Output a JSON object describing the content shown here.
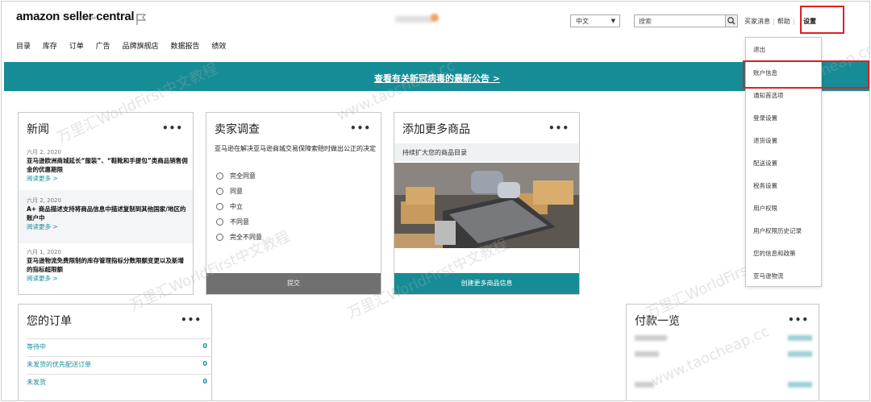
{
  "header": {
    "logo_main": "amazon seller central",
    "logo_sub": "europe",
    "language": "中文",
    "search_placeholder": "搜索",
    "links": [
      "买家消息",
      "帮助"
    ],
    "settings": "设置"
  },
  "nav": [
    "目录",
    "库存",
    "订单",
    "广告",
    "品牌旗舰店",
    "数据报告",
    "绩效"
  ],
  "banner": "查看有关新冠病毒的最新公告 >",
  "news": {
    "title": "新闻",
    "items": [
      {
        "date": "六月 2, 2020",
        "text": "亚马逊欧洲商城延长“服装”、“鞋靴和手提包”类商品销售佣金的优惠期限",
        "more": "阅读更多 >"
      },
      {
        "date": "六月 2, 2020",
        "text": "A+ 商品描述支持将商品信息中描述复制到其他国家/地区的账户中",
        "more": "阅读更多 >"
      },
      {
        "date": "六月 1, 2020",
        "text": "亚马逊物流免费限制的库存管理指标分数限额变更以及新增的指标超限额",
        "more": "阅读更多 >"
      }
    ]
  },
  "survey": {
    "title": "卖家调查",
    "question": "亚马逊在解决亚马逊商城交易保障索赔时做出公正的决定",
    "options": [
      "完全同意",
      "同意",
      "中立",
      "不同意",
      "完全不同意"
    ],
    "submit": "提交"
  },
  "add_products": {
    "title": "添加更多商品",
    "subtitle": "持续扩大您的商品目录",
    "button": "创建更多商品信息"
  },
  "orders": {
    "title": "您的订单",
    "rows": [
      {
        "label": "等待中",
        "count": "0"
      },
      {
        "label": "未发货的优先配送订单",
        "count": "0"
      },
      {
        "label": "未发货",
        "count": "0"
      }
    ]
  },
  "payments": {
    "title": "付款一览"
  },
  "dropdown": {
    "items": [
      "退出",
      "账户信息",
      "通知首选项",
      "登录设置",
      "退货设置",
      "配送设置",
      "税务设置",
      "用户权限",
      "用户权限历史记录",
      "您的信息和政策",
      "亚马逊物流"
    ]
  },
  "watermarks": [
    "万里汇WorldFirst中文教程",
    "www.taocheap.cc"
  ],
  "colors": {
    "teal": "#168c96",
    "highlight": "#e02020",
    "submit_gray": "#707070"
  }
}
